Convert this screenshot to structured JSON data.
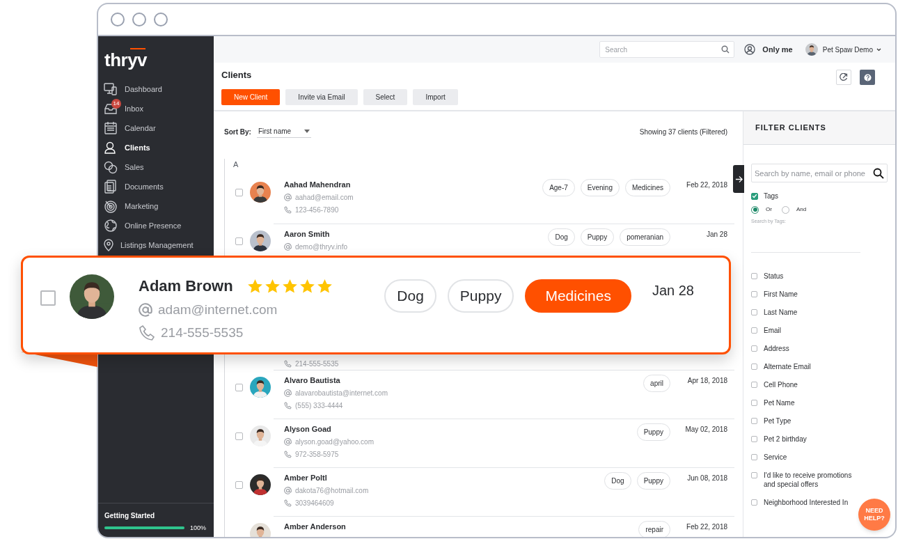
{
  "sidebar": {
    "logo": "thryv",
    "items": [
      {
        "label": "Dashboard",
        "selected": false
      },
      {
        "label": "Inbox",
        "selected": false,
        "badge": "14"
      },
      {
        "label": "Calendar",
        "selected": false
      },
      {
        "label": "Clients",
        "selected": true
      },
      {
        "label": "Sales",
        "selected": false
      },
      {
        "label": "Documents",
        "selected": false
      },
      {
        "label": "Marketing",
        "selected": false
      },
      {
        "label": "Online Presence",
        "selected": false
      },
      {
        "label": "Listings Management",
        "selected": false
      }
    ],
    "progress": {
      "label": "Getting Started",
      "level": 1,
      "reading": "100%"
    }
  },
  "top_bar": {
    "search": {
      "placeholder": "Search"
    },
    "scope": "Only me",
    "account": "Pet Spaw Demo"
  },
  "header": {
    "title": "Clients",
    "buttons": [
      {
        "label": "New Client",
        "primary": true
      },
      {
        "label": "Invite via Email",
        "primary": false
      },
      {
        "label": "Select",
        "primary": false
      },
      {
        "label": "Import",
        "primary": false
      }
    ]
  },
  "list": {
    "sort_label": "Sort By:",
    "sort_value": "First name",
    "count": "Showing 37 clients (Filtered)",
    "section": "A",
    "rows": [
      {
        "name": "Aahad Mahendran",
        "email": "aahad@email.com",
        "phone": "123-456-7890",
        "tags": [
          "Age-7",
          "Evening",
          "Medicines"
        ],
        "date": "Feb 22, 2018",
        "checked": false
      },
      {
        "name": "Aaron Smith",
        "email": "demo@thryv.info",
        "tags": [
          "Dog",
          "Puppy",
          "pomeranian"
        ],
        "date": "Jan 28",
        "checked": false
      },
      {
        "phone": "214-555-5535"
      },
      {
        "name": "Alvaro Bautista",
        "email": "alavarobautista@internet.com",
        "phone": "(555) 333-4444",
        "tags": [
          "april"
        ],
        "date": "Apr 18, 2018",
        "checked": false
      },
      {
        "name": "Alyson Goad",
        "email": "alyson.goad@yahoo.com",
        "phone": "972-358-5975",
        "tags": [
          "Puppy"
        ],
        "date": "May 02, 2018",
        "checked": false
      },
      {
        "name": "Amber Poltl",
        "email": "dakota76@hotmail.com",
        "phone": "3039464609",
        "tags": [
          "Dog",
          "Puppy"
        ],
        "date": "Jun 08, 2018",
        "checked": false
      },
      {
        "name": "Amber Anderson",
        "tags": [
          "repair"
        ],
        "date": "Feb 22, 2018"
      }
    ]
  },
  "callout": {
    "name": "Adam Brown",
    "stars": 5,
    "email": "adam@internet.com",
    "phone": "214-555-5535",
    "checked": false,
    "date": "Jan 28",
    "tags": [
      {
        "label": "Dog",
        "highlighted": false
      },
      {
        "label": "Puppy",
        "highlighted": false
      },
      {
        "label": "Medicines",
        "highlighted": true
      }
    ]
  },
  "filter": {
    "title": "FILTER CLIENTS",
    "search": {
      "placeholder": "Search by name, email or phone"
    },
    "tags": {
      "label": "Tags",
      "checked": true,
      "hint": "Search by Tags:",
      "modes": [
        {
          "label": "Or",
          "selected": true
        },
        {
          "label": "And",
          "selected": false
        }
      ]
    },
    "fields": [
      {
        "label": "Status",
        "checked": false
      },
      {
        "label": "First Name",
        "checked": false
      },
      {
        "label": "Last Name",
        "checked": false
      },
      {
        "label": "Email",
        "checked": false
      },
      {
        "label": "Address",
        "checked": false
      },
      {
        "label": "Alternate Email",
        "checked": false
      },
      {
        "label": "Cell Phone",
        "checked": false
      },
      {
        "label": "Pet Name",
        "checked": false
      },
      {
        "label": "Pet Type",
        "checked": false
      },
      {
        "label": "Pet 2 birthday",
        "checked": false
      },
      {
        "label": "Service",
        "checked": false
      },
      {
        "label": "I'd like to receive promotions and special offers",
        "checked": false
      },
      {
        "label": "Neighborhood Interested In",
        "checked": false
      }
    ]
  },
  "help_button": "NEED HELP?"
}
